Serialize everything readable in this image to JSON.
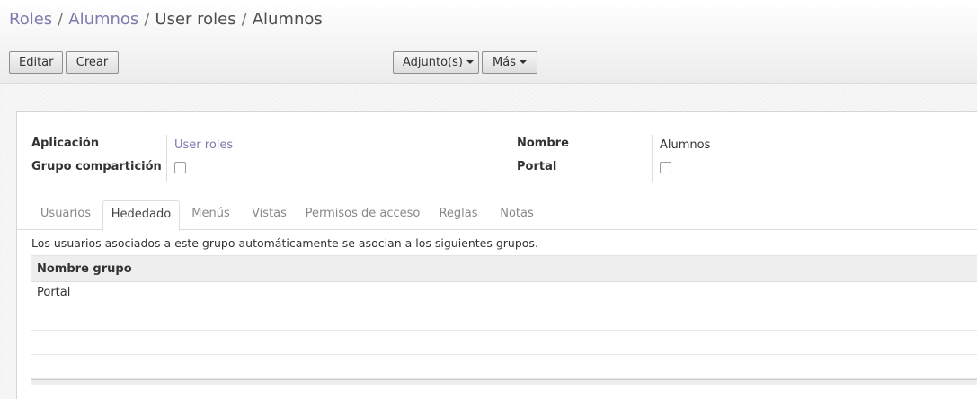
{
  "breadcrumb": {
    "items": [
      {
        "label": "Roles",
        "link": true
      },
      {
        "label": "Alumnos",
        "link": true
      },
      {
        "label": "User roles",
        "link": false
      },
      {
        "label": "Alumnos",
        "link": false
      }
    ],
    "separator": "/"
  },
  "toolbar": {
    "edit_label": "Editar",
    "create_label": "Crear",
    "attachments_label": "Adjunto(s)",
    "more_label": "Más"
  },
  "form": {
    "left": {
      "application_label": "Aplicación",
      "application_value": "User roles",
      "share_group_label": "Grupo compartición",
      "share_group_checked": false
    },
    "right": {
      "name_label": "Nombre",
      "name_value": "Alumnos",
      "portal_label": "Portal",
      "portal_checked": false
    }
  },
  "tabs": [
    {
      "label": "Usuarios",
      "active": false
    },
    {
      "label": "Hededado",
      "active": true
    },
    {
      "label": "Menús",
      "active": false
    },
    {
      "label": "Vistas",
      "active": false
    },
    {
      "label": "Permisos de acceso",
      "active": false
    },
    {
      "label": "Reglas",
      "active": false
    },
    {
      "label": "Notas",
      "active": false
    }
  ],
  "inherited": {
    "help_text": "Los usuarios asociados a este grupo automáticamente se asocian a los siguientes grupos.",
    "column_header": "Nombre grupo",
    "rows": [
      "Portal",
      "",
      "",
      ""
    ]
  },
  "colors": {
    "link": "#7c7bad",
    "text": "#333333"
  }
}
